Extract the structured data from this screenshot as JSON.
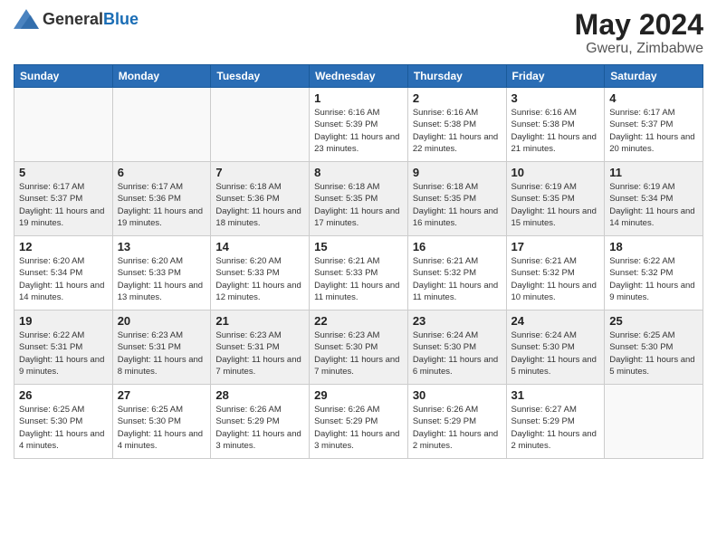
{
  "header": {
    "logo_general": "General",
    "logo_blue": "Blue",
    "month_title": "May 2024",
    "location": "Gweru, Zimbabwe"
  },
  "days_of_week": [
    "Sunday",
    "Monday",
    "Tuesday",
    "Wednesday",
    "Thursday",
    "Friday",
    "Saturday"
  ],
  "weeks": [
    [
      {
        "day": "",
        "info": ""
      },
      {
        "day": "",
        "info": ""
      },
      {
        "day": "",
        "info": ""
      },
      {
        "day": "1",
        "info": "Sunrise: 6:16 AM\nSunset: 5:39 PM\nDaylight: 11 hours\nand 23 minutes."
      },
      {
        "day": "2",
        "info": "Sunrise: 6:16 AM\nSunset: 5:38 PM\nDaylight: 11 hours\nand 22 minutes."
      },
      {
        "day": "3",
        "info": "Sunrise: 6:16 AM\nSunset: 5:38 PM\nDaylight: 11 hours\nand 21 minutes."
      },
      {
        "day": "4",
        "info": "Sunrise: 6:17 AM\nSunset: 5:37 PM\nDaylight: 11 hours\nand 20 minutes."
      }
    ],
    [
      {
        "day": "5",
        "info": "Sunrise: 6:17 AM\nSunset: 5:37 PM\nDaylight: 11 hours\nand 19 minutes."
      },
      {
        "day": "6",
        "info": "Sunrise: 6:17 AM\nSunset: 5:36 PM\nDaylight: 11 hours\nand 19 minutes."
      },
      {
        "day": "7",
        "info": "Sunrise: 6:18 AM\nSunset: 5:36 PM\nDaylight: 11 hours\nand 18 minutes."
      },
      {
        "day": "8",
        "info": "Sunrise: 6:18 AM\nSunset: 5:35 PM\nDaylight: 11 hours\nand 17 minutes."
      },
      {
        "day": "9",
        "info": "Sunrise: 6:18 AM\nSunset: 5:35 PM\nDaylight: 11 hours\nand 16 minutes."
      },
      {
        "day": "10",
        "info": "Sunrise: 6:19 AM\nSunset: 5:35 PM\nDaylight: 11 hours\nand 15 minutes."
      },
      {
        "day": "11",
        "info": "Sunrise: 6:19 AM\nSunset: 5:34 PM\nDaylight: 11 hours\nand 14 minutes."
      }
    ],
    [
      {
        "day": "12",
        "info": "Sunrise: 6:20 AM\nSunset: 5:34 PM\nDaylight: 11 hours\nand 14 minutes."
      },
      {
        "day": "13",
        "info": "Sunrise: 6:20 AM\nSunset: 5:33 PM\nDaylight: 11 hours\nand 13 minutes."
      },
      {
        "day": "14",
        "info": "Sunrise: 6:20 AM\nSunset: 5:33 PM\nDaylight: 11 hours\nand 12 minutes."
      },
      {
        "day": "15",
        "info": "Sunrise: 6:21 AM\nSunset: 5:33 PM\nDaylight: 11 hours\nand 11 minutes."
      },
      {
        "day": "16",
        "info": "Sunrise: 6:21 AM\nSunset: 5:32 PM\nDaylight: 11 hours\nand 11 minutes."
      },
      {
        "day": "17",
        "info": "Sunrise: 6:21 AM\nSunset: 5:32 PM\nDaylight: 11 hours\nand 10 minutes."
      },
      {
        "day": "18",
        "info": "Sunrise: 6:22 AM\nSunset: 5:32 PM\nDaylight: 11 hours\nand 9 minutes."
      }
    ],
    [
      {
        "day": "19",
        "info": "Sunrise: 6:22 AM\nSunset: 5:31 PM\nDaylight: 11 hours\nand 9 minutes."
      },
      {
        "day": "20",
        "info": "Sunrise: 6:23 AM\nSunset: 5:31 PM\nDaylight: 11 hours\nand 8 minutes."
      },
      {
        "day": "21",
        "info": "Sunrise: 6:23 AM\nSunset: 5:31 PM\nDaylight: 11 hours\nand 7 minutes."
      },
      {
        "day": "22",
        "info": "Sunrise: 6:23 AM\nSunset: 5:30 PM\nDaylight: 11 hours\nand 7 minutes."
      },
      {
        "day": "23",
        "info": "Sunrise: 6:24 AM\nSunset: 5:30 PM\nDaylight: 11 hours\nand 6 minutes."
      },
      {
        "day": "24",
        "info": "Sunrise: 6:24 AM\nSunset: 5:30 PM\nDaylight: 11 hours\nand 5 minutes."
      },
      {
        "day": "25",
        "info": "Sunrise: 6:25 AM\nSunset: 5:30 PM\nDaylight: 11 hours\nand 5 minutes."
      }
    ],
    [
      {
        "day": "26",
        "info": "Sunrise: 6:25 AM\nSunset: 5:30 PM\nDaylight: 11 hours\nand 4 minutes."
      },
      {
        "day": "27",
        "info": "Sunrise: 6:25 AM\nSunset: 5:30 PM\nDaylight: 11 hours\nand 4 minutes."
      },
      {
        "day": "28",
        "info": "Sunrise: 6:26 AM\nSunset: 5:29 PM\nDaylight: 11 hours\nand 3 minutes."
      },
      {
        "day": "29",
        "info": "Sunrise: 6:26 AM\nSunset: 5:29 PM\nDaylight: 11 hours\nand 3 minutes."
      },
      {
        "day": "30",
        "info": "Sunrise: 6:26 AM\nSunset: 5:29 PM\nDaylight: 11 hours\nand 2 minutes."
      },
      {
        "day": "31",
        "info": "Sunrise: 6:27 AM\nSunset: 5:29 PM\nDaylight: 11 hours\nand 2 minutes."
      },
      {
        "day": "",
        "info": ""
      }
    ]
  ],
  "shaded_rows": [
    1,
    3
  ]
}
